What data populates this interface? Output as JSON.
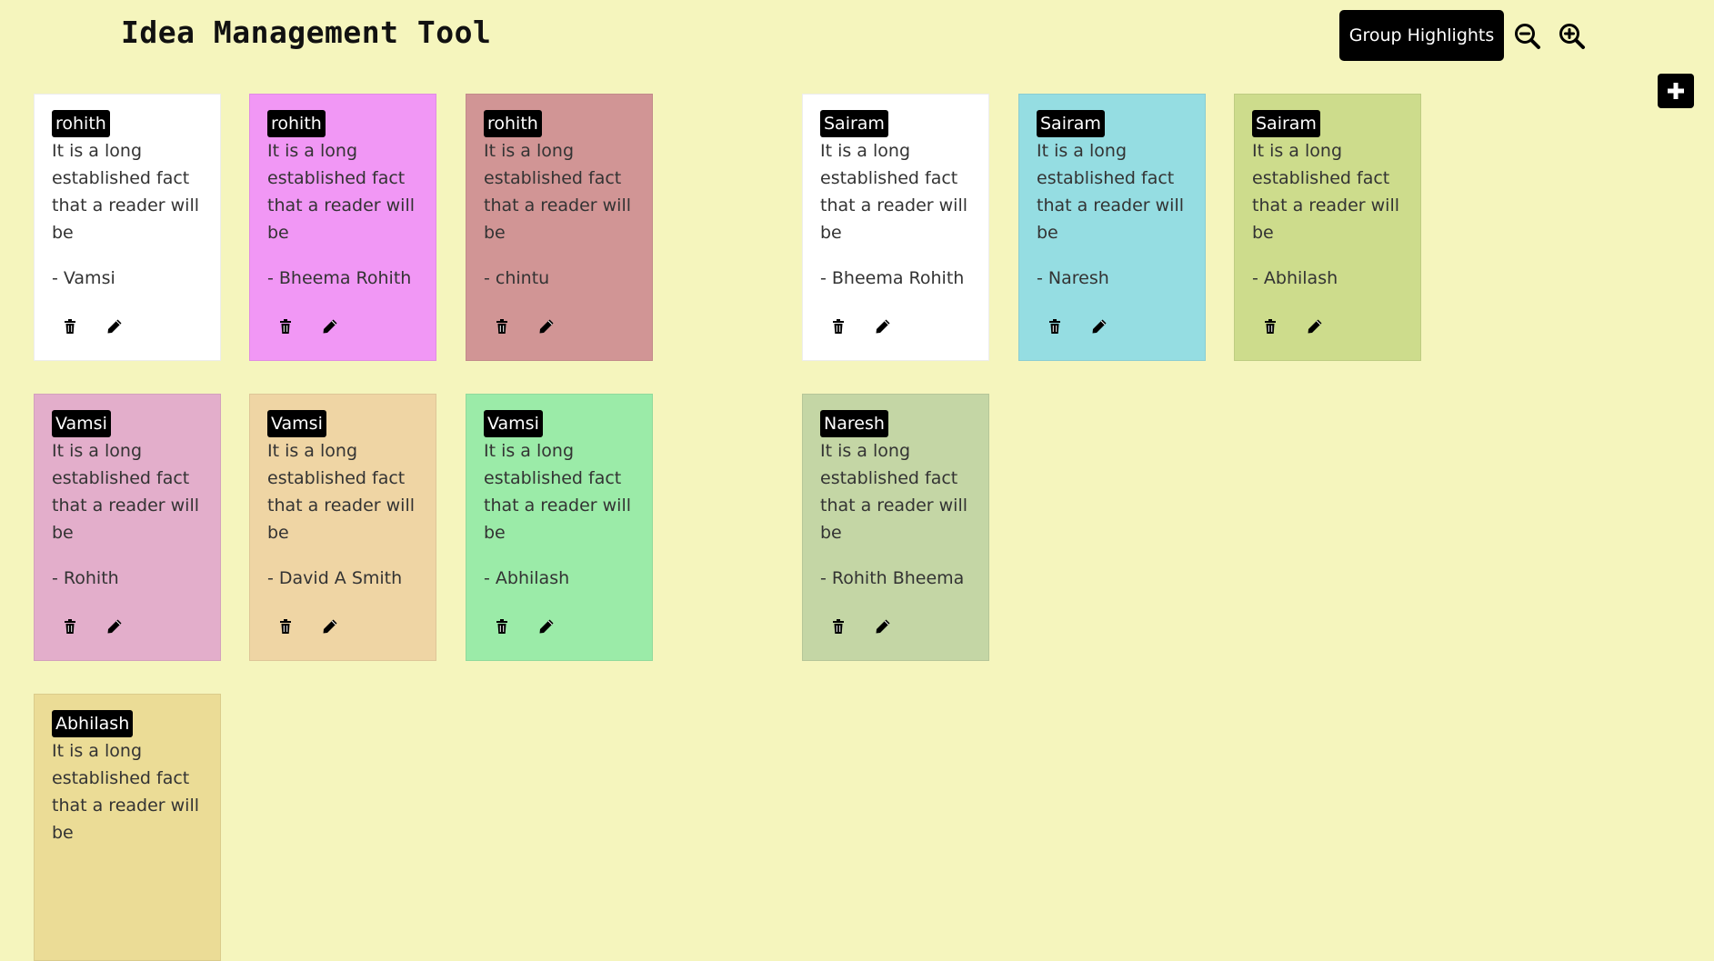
{
  "header": {
    "title": "Idea Management Tool",
    "group_button_label": "Group Highlights",
    "zoom_out_icon": "zoom-out-icon",
    "zoom_in_icon": "zoom-in-icon",
    "add_icon": "plus-icon"
  },
  "notes": [
    {
      "owner": "rohith",
      "text": "It is a long established fact that a reader will be",
      "author": "- Vamsi",
      "color": "#ffffff"
    },
    {
      "owner": "rohith",
      "text": "It is a long established fact that a reader will be",
      "author": "- Bheema Rohith",
      "color": "#f197f5"
    },
    {
      "owner": "rohith",
      "text": "It is a long established fact that a reader will be",
      "author": "- chintu",
      "color": "#d19595"
    },
    {
      "owner": "Sairam",
      "text": "It is a long established fact that a reader will be",
      "author": "- Bheema Rohith",
      "color": "#ffffff"
    },
    {
      "owner": "Sairam",
      "text": "It is a long established fact that a reader will be",
      "author": "- Naresh",
      "color": "#95dde2"
    },
    {
      "owner": "Sairam",
      "text": "It is a long established fact that a reader will be",
      "author": "- Abhilash",
      "color": "#cddc8c"
    },
    {
      "owner": "Vamsi",
      "text": "It is a long established fact that a reader will be",
      "author": "- Rohith",
      "color": "#e3aecb"
    },
    {
      "owner": "Vamsi",
      "text": "It is a long established fact that a reader will be",
      "author": "- David A Smith",
      "color": "#efd5a4"
    },
    {
      "owner": "Vamsi",
      "text": "It is a long established fact that a reader will be",
      "author": "- Abhilash",
      "color": "#9beba8"
    },
    {
      "owner": "Naresh",
      "text": "It is a long established fact that a reader will be",
      "author": "- Rohith Bheema",
      "color": "#c4d6a5"
    },
    {
      "owner": "Abhilash",
      "text": "It is a long established fact that a reader will be",
      "author": "",
      "color": "#ebdc96"
    }
  ]
}
